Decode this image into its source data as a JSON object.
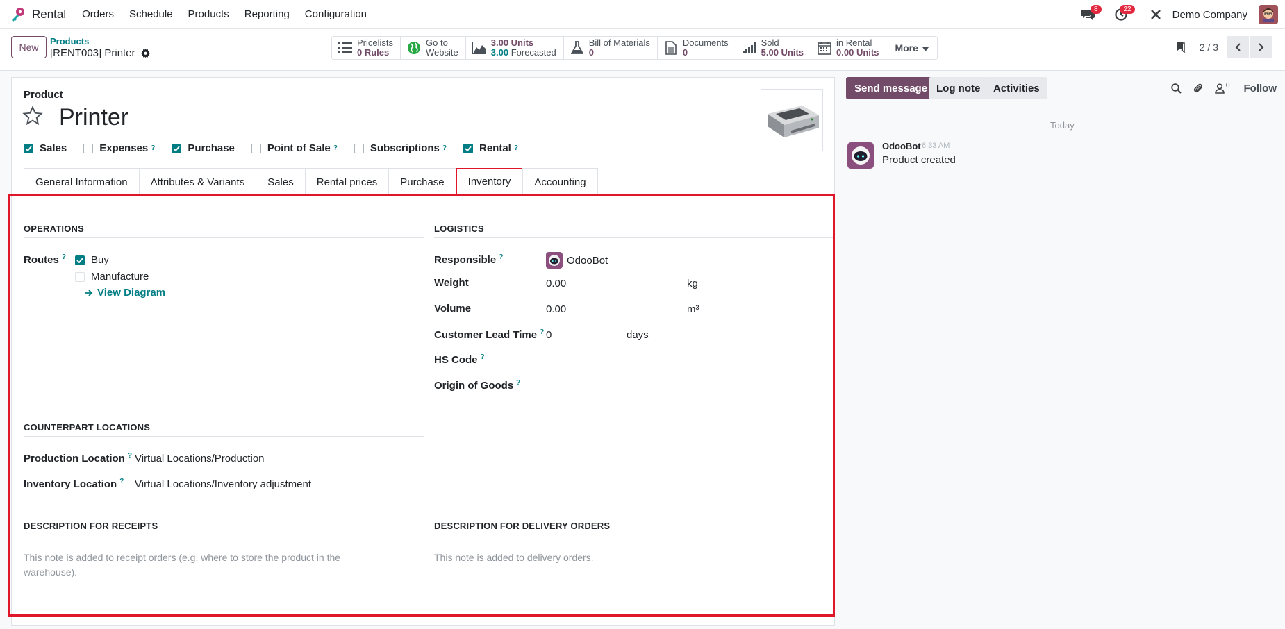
{
  "app": {
    "name": "Rental"
  },
  "menu": [
    "Orders",
    "Schedule",
    "Products",
    "Reporting",
    "Configuration"
  ],
  "nav": {
    "messages_count": "8",
    "activities_count": "22",
    "company": "Demo Company"
  },
  "control": {
    "new_label": "New",
    "breadcrumb_parent": "Products",
    "breadcrumb_current": "[RENT003] Printer",
    "pager": "2 / 3",
    "more_label": "More"
  },
  "smart_buttons": [
    {
      "line1": "Pricelists",
      "line2": "0 Rules",
      "icon": "list-icon"
    },
    {
      "line1": "Go to",
      "line2": "Website",
      "icon": "globe-icon"
    },
    {
      "line1": "3.00 Units",
      "line2a": "3.00",
      "line2b": "Forecasted",
      "icon": "area-chart-icon"
    },
    {
      "line1": "Bill of Materials",
      "line2": "0",
      "icon": "flask-icon"
    },
    {
      "line1": "Documents",
      "line2": "0",
      "icon": "file-icon"
    },
    {
      "line1": "Sold",
      "line2": "5.00 Units",
      "icon": "signal-icon"
    },
    {
      "line1": "in Rental",
      "line2": "0.00 Units",
      "icon": "calendar-icon"
    }
  ],
  "form": {
    "label": "Product",
    "title": "Printer",
    "flags": [
      {
        "label": "Sales",
        "checked": true,
        "help": ""
      },
      {
        "label": "Expenses",
        "checked": false,
        "help": "?"
      },
      {
        "label": "Purchase",
        "checked": true,
        "help": ""
      },
      {
        "label": "Point of Sale",
        "checked": false,
        "help": "?"
      },
      {
        "label": "Subscriptions",
        "checked": false,
        "help": "?"
      },
      {
        "label": "Rental",
        "checked": true,
        "help": "?"
      }
    ],
    "tabs": [
      "General Information",
      "Attributes & Variants",
      "Sales",
      "Rental prices",
      "Purchase",
      "Inventory",
      "Accounting"
    ],
    "active_tab": "Inventory"
  },
  "inventory": {
    "operations_title": "OPERATIONS",
    "routes_label": "Routes",
    "routes": [
      {
        "label": "Buy",
        "checked": true
      },
      {
        "label": "Manufacture",
        "checked": false
      }
    ],
    "view_diagram": "View Diagram",
    "logistics_title": "LOGISTICS",
    "responsible_label": "Responsible",
    "responsible_value": "OdooBot",
    "weight_label": "Weight",
    "weight_value": "0.00",
    "weight_unit": "kg",
    "volume_label": "Volume",
    "volume_value": "0.00",
    "volume_unit": "m³",
    "lead_time_label": "Customer Lead Time",
    "lead_time_value": "0",
    "lead_time_unit": "days",
    "hs_code_label": "HS Code",
    "origin_label": "Origin of Goods",
    "counterpart_title": "COUNTERPART LOCATIONS",
    "production_location_label": "Production Location",
    "production_location_value": "Virtual Locations/Production",
    "inventory_location_label": "Inventory Location",
    "inventory_location_value": "Virtual Locations/Inventory adjustment",
    "receipts_title": "DESCRIPTION FOR RECEIPTS",
    "receipts_placeholder_1": "This note is added to receipt orders (e.g. where to store the product in the",
    "receipts_placeholder_2": "warehouse).",
    "delivery_title": "DESCRIPTION FOR DELIVERY ORDERS",
    "delivery_placeholder": "This note is added to delivery orders."
  },
  "chatter": {
    "send_message": "Send message",
    "log_note": "Log note",
    "activities": "Activities",
    "followers_count": "0",
    "follow": "Follow",
    "date_separator": "Today",
    "messages": [
      {
        "author": "OdooBot",
        "time": "6:33 AM",
        "body": "Product created"
      }
    ]
  },
  "colors": {
    "brand": "#714b67",
    "accent": "#017e84",
    "highlight": "#e0162b",
    "badge": "#e2293f"
  }
}
